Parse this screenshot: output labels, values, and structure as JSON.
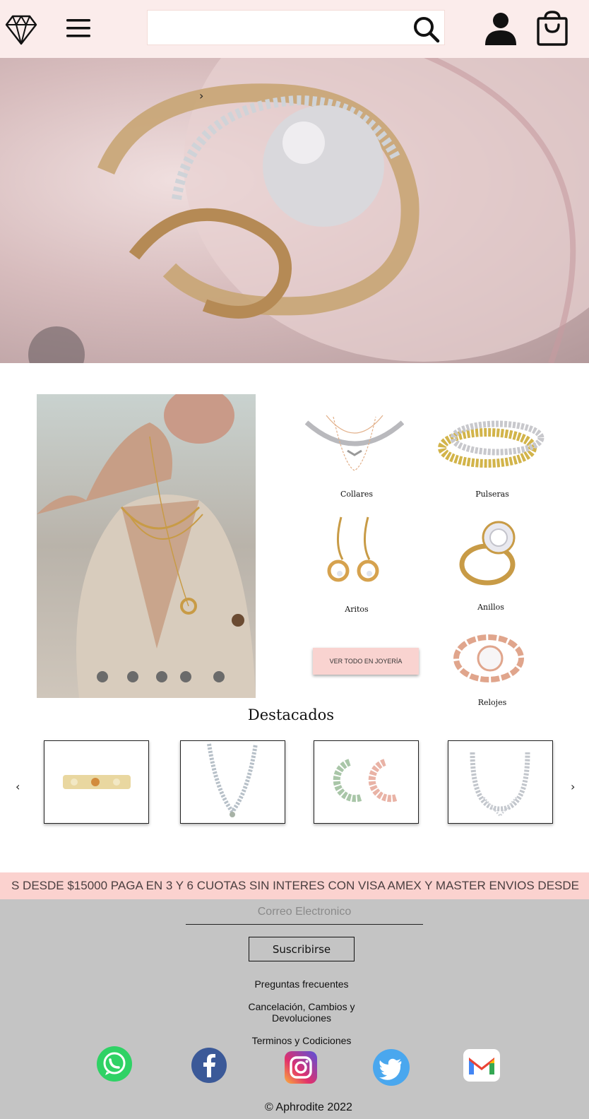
{
  "header": {
    "logo_icon": "diamond-icon",
    "menu_icon": "hamburger-menu-icon",
    "search": {
      "placeholder": "",
      "value": "",
      "icon": "search-icon"
    },
    "user_icon": "user-icon",
    "cart_icon": "shopping-bag-icon"
  },
  "hero": {
    "next_arrow": "›"
  },
  "categories": {
    "items": [
      {
        "label": "Collares",
        "icon": "necklace"
      },
      {
        "label": "Pulseras",
        "icon": "bracelet"
      },
      {
        "label": "Aritos",
        "icon": "earrings"
      },
      {
        "label": "Anillos",
        "icon": "ring"
      },
      {
        "label": "Relojes",
        "icon": "watch"
      }
    ],
    "view_all_label": "VER TODO EN JOYERÍA",
    "slider_dots": 5
  },
  "featured": {
    "title": "Destacados",
    "prev_arrow": "‹",
    "next_arrow": "›",
    "products": [
      {
        "icon": "bracelet-image"
      },
      {
        "icon": "necklace-image"
      },
      {
        "icon": "earrings-image"
      },
      {
        "icon": "necklace-image"
      }
    ]
  },
  "banner": {
    "text": "S DESDE $15000  PAGA EN 3 Y 6 CUOTAS SIN INTERES CON VISA AMEX Y MASTER  ENVIOS DESDE"
  },
  "footer": {
    "email_placeholder": "Correo Electronico",
    "subscribe_label": "Suscribirse",
    "links": {
      "faq": "Preguntas frecuentes",
      "returns_line1": "Cancelación, Cambios y",
      "returns_line2": "Devoluciones",
      "terms": "Terminos y Codiciones"
    },
    "social": [
      "whatsapp-icon",
      "facebook-icon",
      "instagram-icon",
      "twitter-icon",
      "gmail-icon"
    ],
    "copyright": "© Aphrodite 2022"
  },
  "colors": {
    "header_bg": "#fbeceb",
    "banner_bg": "#fbd2cf",
    "footer_bg": "#c4c4c4",
    "button_pink": "#f9d3d0"
  }
}
